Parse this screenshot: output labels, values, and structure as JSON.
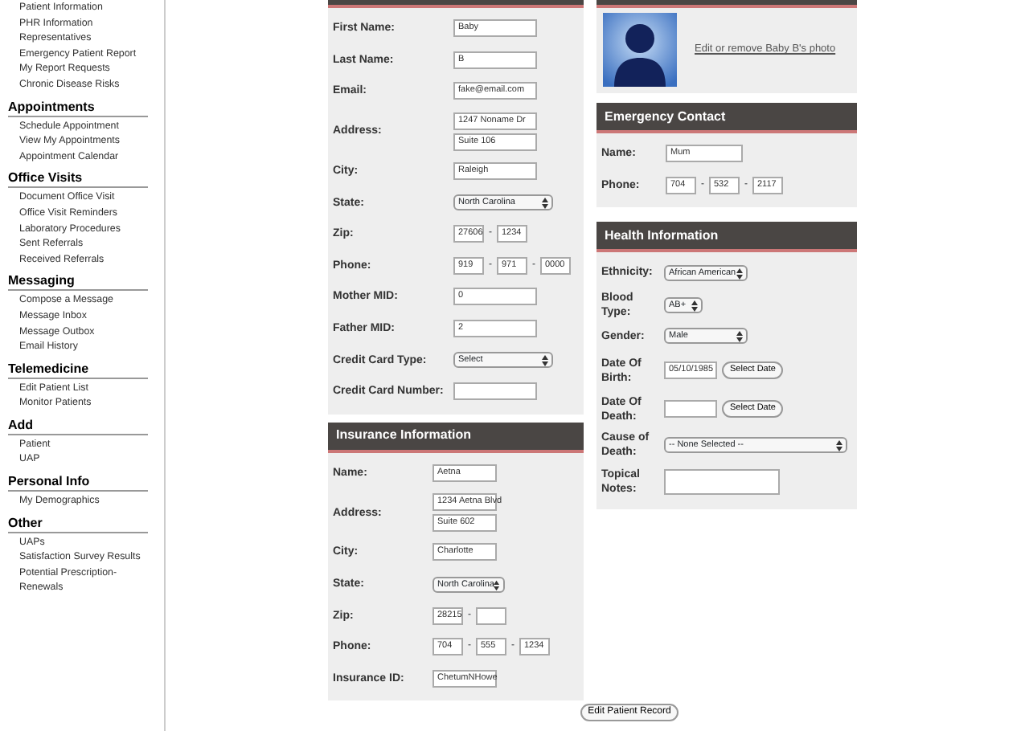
{
  "sidebar": [
    {
      "items": [
        "Patient Information",
        "PHR Information",
        "Representatives",
        "Emergency Patient Report",
        "My Report Requests",
        "Chronic Disease Risks"
      ]
    },
    {
      "title": "Appointments",
      "items": [
        "Schedule Appointment",
        "View My Appointments",
        "Appointment Calendar"
      ]
    },
    {
      "title": "Office Visits",
      "items": [
        "Document Office Visit",
        "Office Visit Reminders",
        "Laboratory Procedures",
        "Sent Referrals",
        "Received Referrals"
      ]
    },
    {
      "title": "Messaging",
      "items": [
        "Compose a Message",
        "Message Inbox",
        "Message Outbox",
        "Email History"
      ]
    },
    {
      "title": "Telemedicine",
      "items": [
        "Edit Patient List",
        "Monitor Patients"
      ]
    },
    {
      "title": "Add",
      "items": [
        "Patient",
        "UAP"
      ]
    },
    {
      "title": "Personal Info",
      "items": [
        "My Demographics"
      ]
    },
    {
      "title": "Other",
      "items": [
        "UAPs",
        "Satisfaction Survey Results",
        "Potential Prescription-Renewals"
      ]
    }
  ],
  "patient_info": {
    "fields": [
      {
        "label": "First Name:",
        "kind": "text",
        "value": "Baby"
      },
      {
        "label": "Last Name:",
        "kind": "text",
        "value": "B"
      },
      {
        "label": "Email:",
        "kind": "text",
        "value": "fake@email.com"
      },
      {
        "label": "Address:",
        "kind": "address",
        "values": [
          "1247 Noname Dr",
          "Suite 106"
        ]
      },
      {
        "label": "City:",
        "kind": "text",
        "value": "Raleigh"
      },
      {
        "label": "State:",
        "kind": "select",
        "value": "North Carolina"
      },
      {
        "label": "Zip:",
        "kind": "zip",
        "values": [
          "27606",
          "1234"
        ],
        "separators": [
          "-"
        ]
      },
      {
        "label": "Phone:",
        "kind": "phone",
        "values": [
          "919",
          "971",
          "0000"
        ],
        "separators": [
          "-",
          "-"
        ]
      },
      {
        "label": "Mother MID:",
        "kind": "text",
        "value": "0"
      },
      {
        "label": "Father MID:",
        "kind": "text",
        "value": "2"
      },
      {
        "label": "Credit Card Type:",
        "kind": "select",
        "value": "Select"
      },
      {
        "label": "Credit Card Number:",
        "kind": "text"
      }
    ]
  },
  "insurance": {
    "title": "Insurance Information",
    "fields": [
      {
        "label": "Name:",
        "kind": "text",
        "value": "Aetna"
      },
      {
        "label": "Address:",
        "kind": "address",
        "values": [
          "1234 Aetna Blvd",
          "Suite 602"
        ]
      },
      {
        "label": "City:",
        "kind": "text",
        "value": "Charlotte"
      },
      {
        "label": "State:",
        "kind": "select",
        "value": "North Carolina"
      },
      {
        "label": "Zip:",
        "kind": "zip",
        "values": [
          "28215"
        ],
        "separators": [
          "-"
        ]
      },
      {
        "label": "Phone:",
        "kind": "phone",
        "values": [
          "704",
          "555",
          "1234"
        ],
        "separators": [
          "-",
          "-"
        ]
      },
      {
        "label": "Insurance ID:",
        "kind": "text",
        "value": "ChetumNHowe"
      }
    ]
  },
  "photo": {
    "link": "Edit or remove Baby B's photo"
  },
  "emergency_contact": {
    "title": "Emergency Contact",
    "fields": [
      {
        "label": "Name:",
        "kind": "text",
        "value": "Mum"
      },
      {
        "label": "Phone:",
        "kind": "phone",
        "values": [
          "704",
          "532",
          "2117"
        ],
        "separators": [
          "-",
          "-"
        ]
      }
    ]
  },
  "health": {
    "title": "Health Information",
    "fields": [
      {
        "label": "Ethnicity:",
        "kind": "select",
        "value": "African American"
      },
      {
        "label": "Blood Type:",
        "kind": "smallselect",
        "value": "AB+"
      },
      {
        "label": "Gender:",
        "kind": "select",
        "value": "Male"
      },
      {
        "label": "Date Of Birth:",
        "kind": "date",
        "value": "05/10/1985",
        "button": "Select Date"
      },
      {
        "label": "Date Of Death:",
        "kind": "date",
        "button": "Select Date"
      },
      {
        "label": "Cause of Death:",
        "kind": "wideselect",
        "value": "-- None Selected --"
      },
      {
        "label": "Topical Notes:",
        "kind": "textarea"
      }
    ]
  },
  "submit": "Edit Patient Record"
}
